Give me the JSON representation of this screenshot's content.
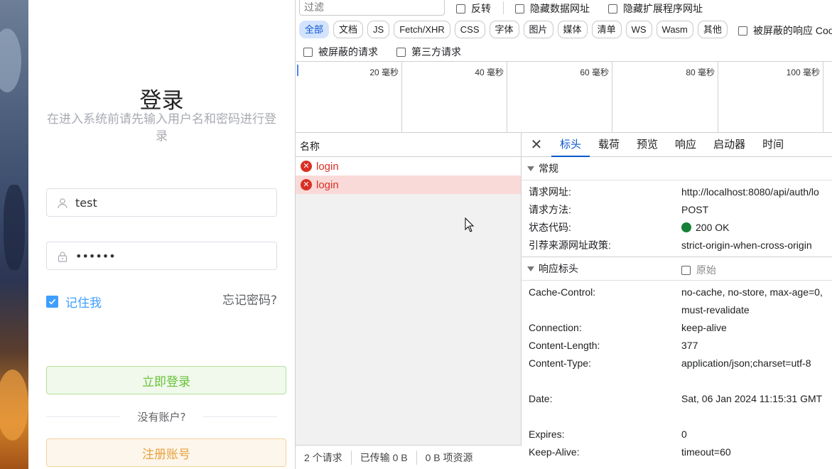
{
  "login": {
    "title": "登录",
    "subtitle": "在进入系统前请先输入用户名和密码进行登录",
    "username_value": "test",
    "password_value": "••••••",
    "remember_label": "记住我",
    "forgot_label": "忘记密码?",
    "login_button": "立即登录",
    "no_account": "没有账户?",
    "register_button": "注册账号",
    "accent_color": "#409eff"
  },
  "devtools": {
    "filter_placeholder": "过滤",
    "invert_label": "反转",
    "hide_data_urls": "隐藏数据网址",
    "hide_ext_urls": "隐藏扩展程序网址",
    "type_filters": [
      "全部",
      "文档",
      "JS",
      "Fetch/XHR",
      "CSS",
      "字体",
      "图片",
      "媒体",
      "清单",
      "WS",
      "Wasm",
      "其他"
    ],
    "blocked_cookies": "被屏蔽的响应 Coo",
    "blocked_requests": "被屏蔽的请求",
    "third_party": "第三方请求",
    "timeline_ticks": [
      "20 毫秒",
      "40 毫秒",
      "60 毫秒",
      "80 毫秒",
      "100 毫秒"
    ],
    "name_header": "名称",
    "requests": [
      {
        "name": "login",
        "selected": false
      },
      {
        "name": "login",
        "selected": true
      }
    ],
    "status": {
      "requests": "2 个请求",
      "transferred": "已传输 0 B",
      "resources": "0 B 项资源"
    },
    "detail_tabs": [
      "标头",
      "载荷",
      "预览",
      "响应",
      "启动器",
      "时间"
    ],
    "general": {
      "title": "常规",
      "rows": [
        {
          "k": "请求网址:",
          "v": "http://localhost:8080/api/auth/lo"
        },
        {
          "k": "请求方法:",
          "v": "POST"
        },
        {
          "k": "状态代码:",
          "v": "200 OK"
        },
        {
          "k": "引荐来源网址政策:",
          "v": "strict-origin-when-cross-origin"
        }
      ]
    },
    "response_headers": {
      "title": "响应标头",
      "raw_label": "原始",
      "rows": [
        {
          "k": "Cache-Control:",
          "v": "no-cache, no-store, max-age=0, must-revalidate"
        },
        {
          "k": "Connection:",
          "v": "keep-alive"
        },
        {
          "k": "Content-Length:",
          "v": "377"
        },
        {
          "k": "Content-Type:",
          "v": "application/json;charset=utf-8"
        },
        {
          "k": "Date:",
          "v": "Sat, 06 Jan 2024 11:15:31 GMT"
        },
        {
          "k": "Expires:",
          "v": "0"
        },
        {
          "k": "Keep-Alive:",
          "v": "timeout=60"
        }
      ]
    },
    "status_ok_color": "#188038",
    "error_color": "#d93025"
  }
}
